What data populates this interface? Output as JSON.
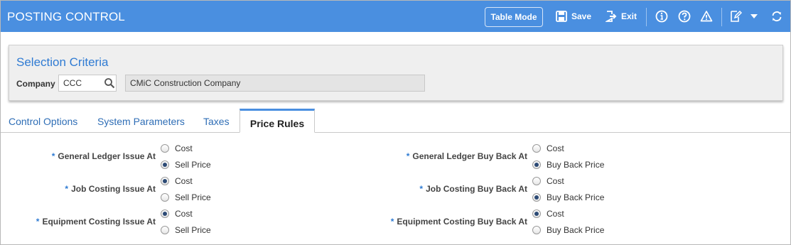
{
  "header": {
    "title": "POSTING CONTROL",
    "table_mode_label": "Table Mode",
    "save_label": "Save",
    "exit_label": "Exit",
    "bg_color": "#4a8fe0"
  },
  "selection": {
    "title": "Selection Criteria",
    "company_label": "Company",
    "company_code": "CCC",
    "company_name": "CMiC Construction Company"
  },
  "tabs": [
    {
      "label": "Control Options",
      "active": false
    },
    {
      "label": "System Parameters",
      "active": false
    },
    {
      "label": "Taxes",
      "active": false
    },
    {
      "label": "Price Rules",
      "active": true
    }
  ],
  "form": {
    "required_marker": "*",
    "left": [
      {
        "label": "General Ledger Issue At",
        "options": [
          "Cost",
          "Sell Price"
        ],
        "selected": "Sell Price"
      },
      {
        "label": "Job Costing Issue At",
        "options": [
          "Cost",
          "Sell Price"
        ],
        "selected": "Cost"
      },
      {
        "label": "Equipment Costing Issue At",
        "options": [
          "Cost",
          "Sell Price"
        ],
        "selected": "Cost"
      }
    ],
    "right": [
      {
        "label": "General Ledger Buy Back At",
        "options": [
          "Cost",
          "Buy Back Price"
        ],
        "selected": "Buy Back Price"
      },
      {
        "label": "Job Costing Buy Back At",
        "options": [
          "Cost",
          "Buy Back Price"
        ],
        "selected": "Buy Back Price"
      },
      {
        "label": "Equipment Costing Buy Back At",
        "options": [
          "Cost",
          "Buy Back Price"
        ],
        "selected": "Cost"
      }
    ]
  }
}
